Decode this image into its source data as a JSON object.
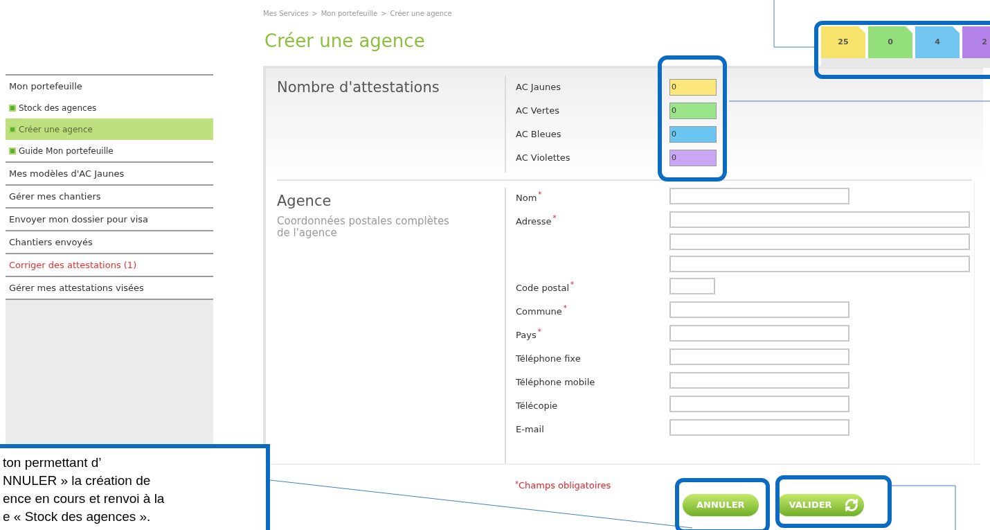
{
  "breadcrumb": [
    "Mes Services",
    "Mon portefeuille",
    "Créer une agence"
  ],
  "breadcrumb_separator": ">",
  "page_title": "Créer une agence",
  "counters": [
    {
      "value": "25",
      "color": "#f7e36c"
    },
    {
      "value": "0",
      "color": "#93df7c"
    },
    {
      "value": "4",
      "color": "#70c6ee"
    },
    {
      "value": "2",
      "color": "#b483ea"
    }
  ],
  "sidebar": {
    "items": [
      {
        "label": "Mon portefeuille",
        "selected": false,
        "alert": false,
        "children": [
          {
            "label": "Stock des agences",
            "selected": false
          },
          {
            "label": "Créer une agence",
            "selected": true
          },
          {
            "label": "Guide Mon portefeuille",
            "selected": false
          }
        ]
      },
      {
        "label": "Mes modèles d'AC Jaunes",
        "selected": false,
        "alert": false
      },
      {
        "label": "Gérer mes chantiers",
        "selected": false,
        "alert": false
      },
      {
        "label": "Envoyer mon dossier pour visa",
        "selected": false,
        "alert": false
      },
      {
        "label": "Chantiers envoyés",
        "selected": false,
        "alert": false
      },
      {
        "label": "Corriger des attestations (1)",
        "selected": false,
        "alert": true
      },
      {
        "label": "Gérer mes attestations visées",
        "selected": false,
        "alert": false
      }
    ]
  },
  "attestations": {
    "title": "Nombre d'attestations",
    "rows": [
      {
        "label": "AC Jaunes",
        "value": "0",
        "color": "#fde77a"
      },
      {
        "label": "AC Vertes",
        "value": "0",
        "color": "#9ae489"
      },
      {
        "label": "AC Bleues",
        "value": "0",
        "color": "#6cc6f2"
      },
      {
        "label": "AC Violettes",
        "value": "0",
        "color": "#cba6f5"
      }
    ]
  },
  "agence": {
    "title": "Agence",
    "subtitle": "Coordonnées postales complètes de l'agence",
    "required_mark": "*",
    "fields": [
      {
        "label": "Nom",
        "required": true,
        "kind": "text"
      },
      {
        "label": "Adresse",
        "required": true,
        "kind": "address"
      },
      {
        "label": "Code postal",
        "required": true,
        "kind": "short"
      },
      {
        "label": "Commune",
        "required": true,
        "kind": "text"
      },
      {
        "label": "Pays",
        "required": true,
        "kind": "text"
      },
      {
        "label": "Téléphone fixe",
        "required": false,
        "kind": "text"
      },
      {
        "label": "Téléphone mobile",
        "required": false,
        "kind": "text"
      },
      {
        "label": "Télécopie",
        "required": false,
        "kind": "text"
      },
      {
        "label": "E-mail",
        "required": false,
        "kind": "text"
      }
    ]
  },
  "required_note": {
    "mark": "*",
    "text": "Champs obligatoires"
  },
  "buttons": [
    {
      "label": "ANNULER",
      "kind": "plain"
    },
    {
      "label": "VALIDER",
      "kind": "refresh"
    }
  ],
  "callout": {
    "lines": [
      "ton permettant d’",
      "NNULER » la création de",
      "ence en cours et renvoi à la",
      "e « Stock des agences »."
    ]
  }
}
